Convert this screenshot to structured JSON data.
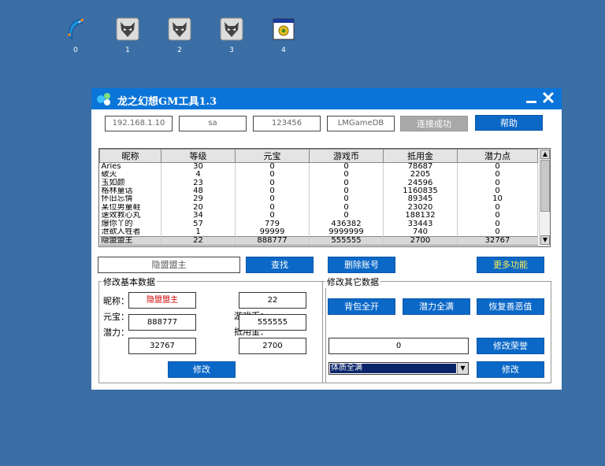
{
  "desktop": {
    "icons": [
      {
        "label": "0",
        "icon": "dolphin-icon"
      },
      {
        "label": "1",
        "icon": "fox-head-icon"
      },
      {
        "label": "2",
        "icon": "fox-head-icon"
      },
      {
        "label": "3",
        "icon": "fox-head-icon"
      },
      {
        "label": "4",
        "icon": "app-window-icon"
      }
    ]
  },
  "window": {
    "title": "龙之幻想GM工具1.3",
    "connection": {
      "host": "192.168.1.10",
      "user": "sa",
      "password": "123456",
      "database": "LMGameDB",
      "status_button": "连接成功",
      "help_button": "帮助"
    },
    "grid": {
      "columns": [
        "昵称",
        "等级",
        "元宝",
        "游戏币",
        "抵用金",
        "潜力点"
      ],
      "rows": [
        [
          "Aries",
          "30",
          "0",
          "0",
          "78687",
          "0"
        ],
        [
          "破灭",
          "4",
          "0",
          "0",
          "2205",
          "0"
        ],
        [
          "玉如颜",
          "23",
          "0",
          "0",
          "24596",
          "0"
        ],
        [
          "格林童话",
          "48",
          "0",
          "0",
          "1160835",
          "0"
        ],
        [
          "怀旧忘情",
          "29",
          "0",
          "0",
          "89345",
          "10"
        ],
        [
          "某位男童鞋",
          "20",
          "0",
          "0",
          "23020",
          "0"
        ],
        [
          "速效救心丸",
          "34",
          "0",
          "0",
          "188132",
          "0"
        ],
        [
          "爆你丫的",
          "57",
          "779",
          "436382",
          "33443",
          "0"
        ],
        [
          "泄欲人牲者",
          "1",
          "99999",
          "9999999",
          "740",
          "0"
        ],
        [
          "隐盟盟主",
          "22",
          "888777",
          "555555",
          "2700",
          "32767"
        ]
      ],
      "selected_row": 9
    },
    "search": {
      "value": "隐盟盟主",
      "find_button": "查找",
      "delete_button": "删除账号",
      "more_button": "更多功能"
    },
    "basic": {
      "caption": "修改基本数据",
      "nick_label": "昵称：",
      "nick_value": "隐盟盟主",
      "level_value": "22",
      "yuanbao_label": "元宝：",
      "yuanbao_value": "888777",
      "coin_label": "游戏币：",
      "coin_value": "555555",
      "potential_label": "潜力：",
      "potential_value": "32767",
      "voucher_label": "抵用金：",
      "voucher_value": "2700",
      "modify_button": "修改"
    },
    "other": {
      "caption": "修改其它数据",
      "bag_button": "背包全开",
      "potential_full_button": "潜力全满",
      "restore_button": "恢复善恶值",
      "honor_value": "0",
      "honor_button": "修改荣誉",
      "select_value": "体质全满",
      "modify_button": "修改"
    }
  }
}
